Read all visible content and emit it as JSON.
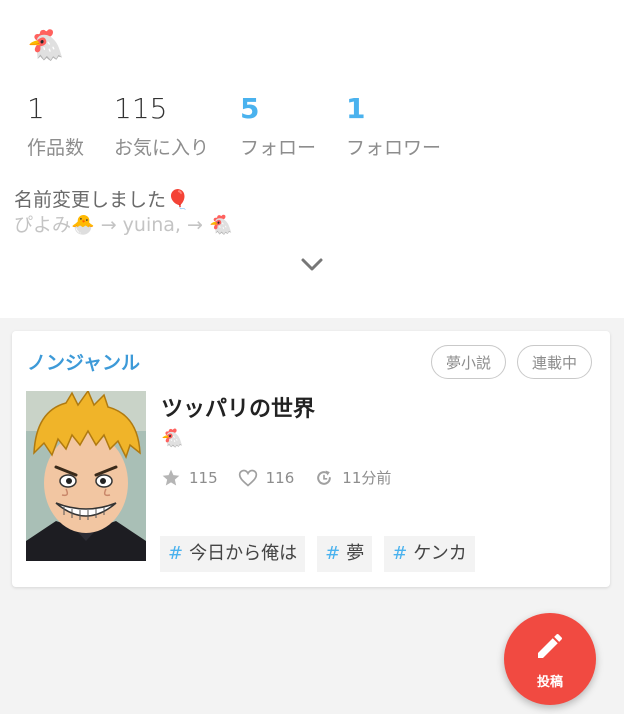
{
  "profile": {
    "avatar_emoji": "🐔",
    "stats": [
      {
        "value": "1",
        "label": "作品数"
      },
      {
        "value": "115",
        "label": "お気に入り"
      },
      {
        "value": "5",
        "label": "フォロー"
      },
      {
        "value": "1",
        "label": "フォロワー"
      }
    ],
    "bio_line1": "名前変更しました🎈",
    "bio_line2": "ぴよみ🐣 → yuina, → 🐔",
    "expand_icon": "chevron-down-icon"
  },
  "work": {
    "genre": "ノンジャンル",
    "badges": [
      "夢小説",
      "連載中"
    ],
    "title": "ツッパリの世界",
    "description": "🐔",
    "favorites": "115",
    "likes": "116",
    "updated": "11分前",
    "tags": [
      "今日から俺は",
      "夢",
      "ケンカ"
    ],
    "tag_prefix": "#"
  },
  "fab": {
    "label": "投稿",
    "icon": "pencil-icon"
  },
  "colors": {
    "accent_blue": "#4ab2ee",
    "genre_blue": "#3d9ad8",
    "fab_red": "#f14a41",
    "muted_gray": "#8d8d8d"
  }
}
